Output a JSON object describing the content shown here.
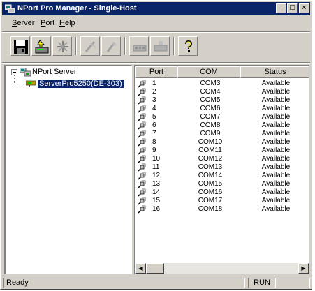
{
  "window": {
    "title": "NPort Pro Manager - Single-Host",
    "controls": [
      "_",
      "□",
      "×"
    ]
  },
  "menu": {
    "items": [
      "Server",
      "Port",
      "Help"
    ]
  },
  "toolbar": {
    "buttons": [
      "save-icon",
      "search-server-icon",
      "network-icon",
      "config-icon",
      "settings-icon",
      "add-port-icon",
      "remove-port-icon",
      "help-icon"
    ]
  },
  "tree": {
    "root_label": "NPort Server",
    "child_label": "ServerPro5250(DE-303)"
  },
  "list": {
    "columns": [
      "Port",
      "COM",
      "Status"
    ],
    "rows": [
      {
        "port": "1",
        "com": "COM3",
        "status": "Available"
      },
      {
        "port": "2",
        "com": "COM4",
        "status": "Available"
      },
      {
        "port": "3",
        "com": "COM5",
        "status": "Available"
      },
      {
        "port": "4",
        "com": "COM6",
        "status": "Available"
      },
      {
        "port": "5",
        "com": "COM7",
        "status": "Available"
      },
      {
        "port": "6",
        "com": "COM8",
        "status": "Available"
      },
      {
        "port": "7",
        "com": "COM9",
        "status": "Available"
      },
      {
        "port": "8",
        "com": "COM10",
        "status": "Available"
      },
      {
        "port": "9",
        "com": "COM11",
        "status": "Available"
      },
      {
        "port": "10",
        "com": "COM12",
        "status": "Available"
      },
      {
        "port": "11",
        "com": "COM13",
        "status": "Available"
      },
      {
        "port": "12",
        "com": "COM14",
        "status": "Available"
      },
      {
        "port": "13",
        "com": "COM15",
        "status": "Available"
      },
      {
        "port": "14",
        "com": "COM16",
        "status": "Available"
      },
      {
        "port": "15",
        "com": "COM17",
        "status": "Available"
      },
      {
        "port": "16",
        "com": "COM18",
        "status": "Available"
      }
    ]
  },
  "status": {
    "text": "Ready",
    "mode": "RUN"
  },
  "colors": {
    "title_bar": "#0a246a",
    "face": "#d4d0c8"
  }
}
